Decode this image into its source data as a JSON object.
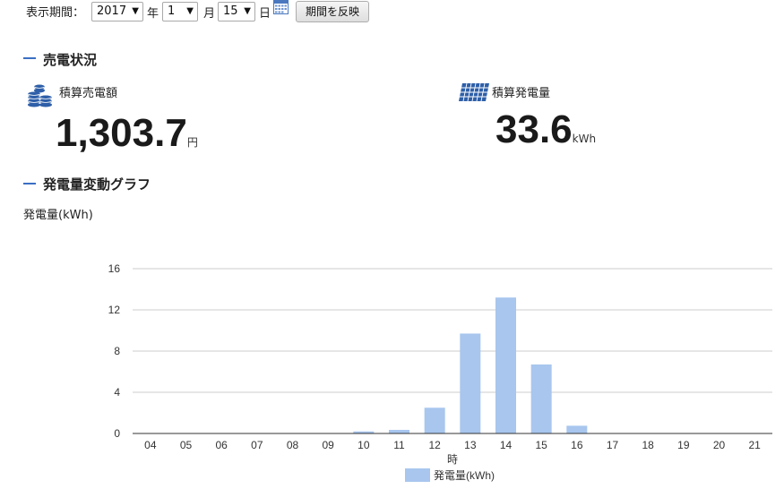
{
  "filter": {
    "label": "表示期間：",
    "year": "2017",
    "year_suffix": "年",
    "month": "1",
    "month_suffix": "月",
    "day": "15",
    "day_suffix": "日",
    "dropdown_glyph": "▼",
    "calendar_icon": "calendar-icon",
    "apply_label": "期間を反映"
  },
  "sales": {
    "heading": "売電状況",
    "amount_label": "積算売電額",
    "amount_value": "1,303.7",
    "amount_unit": "円",
    "amount_icon": "coins-icon",
    "gen_label": "積算発電量",
    "gen_value": "33.6",
    "gen_unit": "kWh",
    "gen_icon": "solar-panel-icon"
  },
  "graph": {
    "heading": "発電量変動グラフ",
    "unit_label": "発電量(kWh)"
  },
  "colors": {
    "accent": "#3a6fc4",
    "bar": "#a8c6ee",
    "icon": "#2e5fa8"
  },
  "chart_data": {
    "type": "bar",
    "categories": [
      "04",
      "05",
      "06",
      "07",
      "08",
      "09",
      "10",
      "11",
      "12",
      "13",
      "14",
      "15",
      "16",
      "17",
      "18",
      "19",
      "20",
      "21"
    ],
    "series": [
      {
        "name": "発電量(kWh)",
        "values": [
          0,
          0,
          0,
          0,
          0,
          0,
          0.2,
          0.35,
          2.5,
          9.7,
          13.2,
          6.7,
          0.75,
          0,
          0,
          0,
          0,
          0
        ]
      }
    ],
    "xlabel": "時",
    "ylabel": "発電量(kWh)",
    "ylim": [
      0,
      16
    ],
    "yticks": [
      0,
      4,
      8,
      12,
      16
    ],
    "grid": true,
    "legend": "bottom"
  }
}
